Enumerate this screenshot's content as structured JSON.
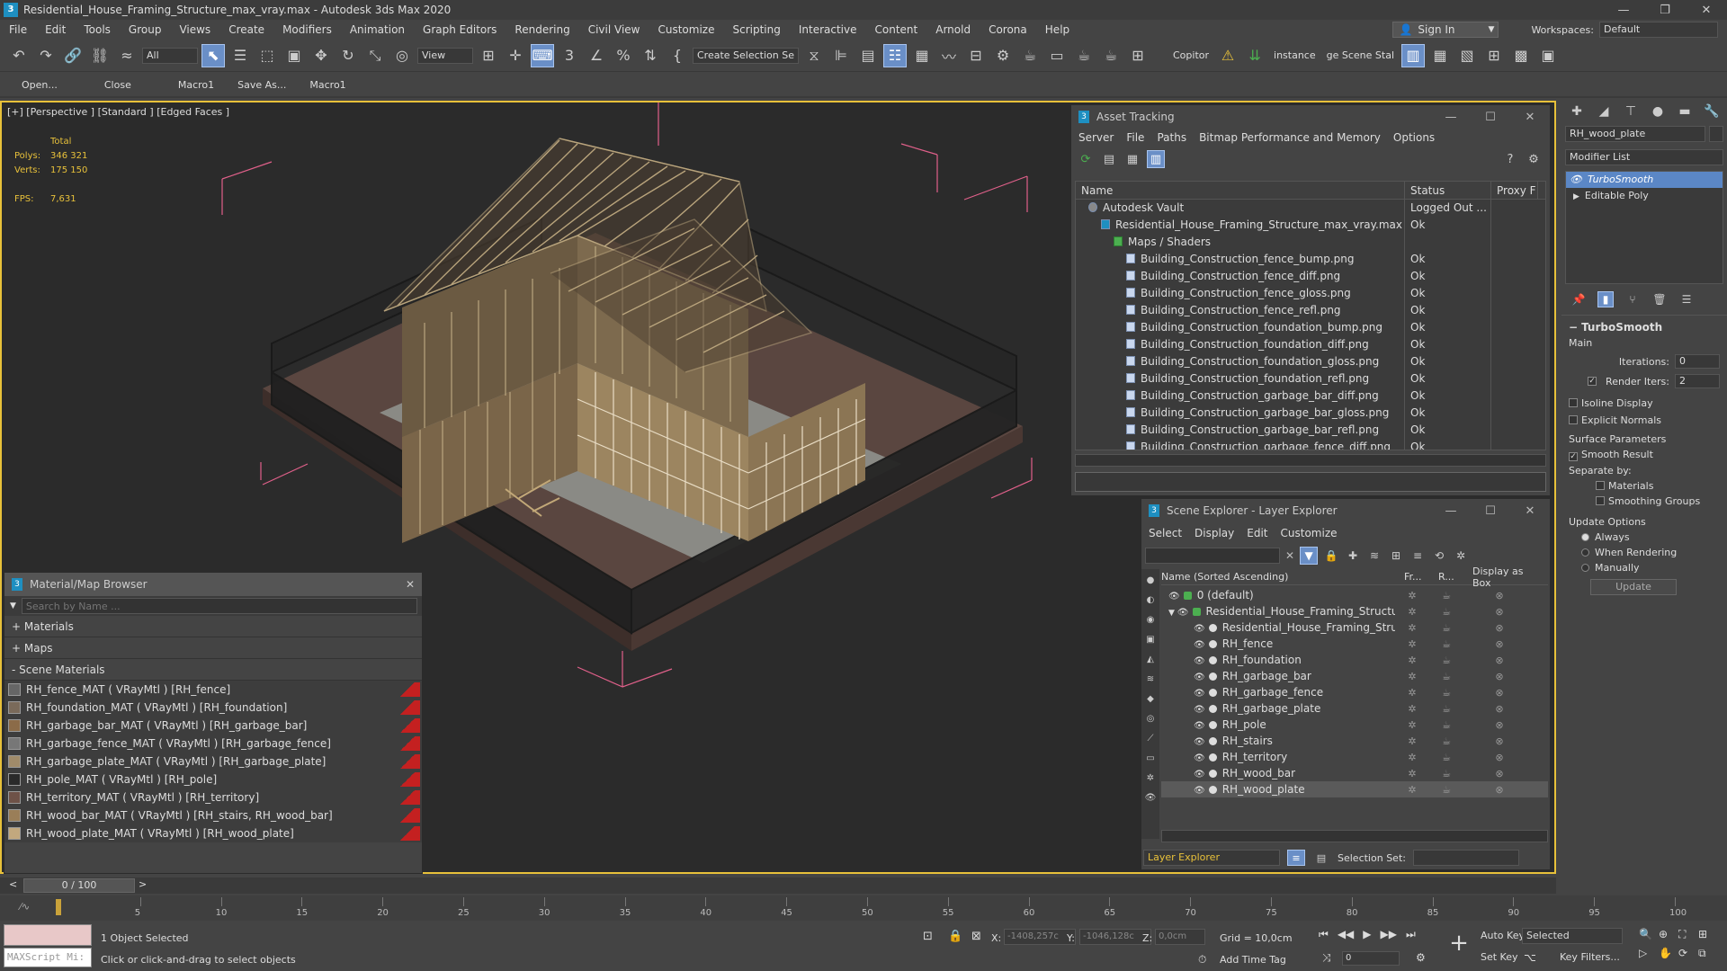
{
  "window": {
    "title": "Residential_House_Framing_Structure_max_vray.max - Autodesk 3ds Max 2020",
    "controls": [
      "—",
      "❐",
      "✕"
    ]
  },
  "menu": [
    "File",
    "Edit",
    "Tools",
    "Group",
    "Views",
    "Create",
    "Modifiers",
    "Animation",
    "Graph Editors",
    "Rendering",
    "Civil View",
    "Customize",
    "Scripting",
    "Interactive",
    "Content",
    "Arnold",
    "Corona",
    "Help"
  ],
  "account": {
    "signin": "Sign In",
    "workspaces_label": "Workspaces:",
    "workspace": "Default"
  },
  "toolbar": {
    "filter": "All",
    "refcoord": "View",
    "selection_set": "Create Selection Se",
    "copitor": "Copitor",
    "instance": "instance",
    "scene_state": "ge Scene Stal"
  },
  "macrobar": [
    "Open...",
    "Close",
    "Macro1",
    "Save As...",
    "Macro1"
  ],
  "viewport": {
    "label": "[+] [Perspective ] [Standard ] [Edged Faces ]",
    "stats": {
      "total_label": "Total",
      "polys_label": "Polys:",
      "polys": "346 321",
      "verts_label": "Verts:",
      "verts": "175 150",
      "fps_label": "FPS:",
      "fps": "7,631"
    }
  },
  "asset_tracking": {
    "title": "Asset Tracking",
    "menu": [
      "Server",
      "File",
      "Paths",
      "Bitmap Performance and Memory",
      "Options"
    ],
    "columns": [
      "Name",
      "Status",
      "Proxy F"
    ],
    "rows": [
      {
        "indent": 1,
        "name": "Autodesk Vault",
        "status": "Logged Out ..."
      },
      {
        "indent": 2,
        "name": "Residential_House_Framing_Structure_max_vray.max",
        "status": "Ok"
      },
      {
        "indent": 3,
        "name": "Maps / Shaders",
        "status": ""
      },
      {
        "indent": 4,
        "name": "Building_Construction_fence_bump.png",
        "status": "Ok"
      },
      {
        "indent": 4,
        "name": "Building_Construction_fence_diff.png",
        "status": "Ok"
      },
      {
        "indent": 4,
        "name": "Building_Construction_fence_gloss.png",
        "status": "Ok"
      },
      {
        "indent": 4,
        "name": "Building_Construction_fence_refl.png",
        "status": "Ok"
      },
      {
        "indent": 4,
        "name": "Building_Construction_foundation_bump.png",
        "status": "Ok"
      },
      {
        "indent": 4,
        "name": "Building_Construction_foundation_diff.png",
        "status": "Ok"
      },
      {
        "indent": 4,
        "name": "Building_Construction_foundation_gloss.png",
        "status": "Ok"
      },
      {
        "indent": 4,
        "name": "Building_Construction_foundation_refl.png",
        "status": "Ok"
      },
      {
        "indent": 4,
        "name": "Building_Construction_garbage_bar_diff.png",
        "status": "Ok"
      },
      {
        "indent": 4,
        "name": "Building_Construction_garbage_bar_gloss.png",
        "status": "Ok"
      },
      {
        "indent": 4,
        "name": "Building_Construction_garbage_bar_refl.png",
        "status": "Ok"
      },
      {
        "indent": 4,
        "name": "Building_Construction_garbage_fence_diff.png",
        "status": "Ok"
      }
    ]
  },
  "scene_explorer": {
    "title": "Scene Explorer - Layer Explorer",
    "menu": [
      "Select",
      "Display",
      "Edit",
      "Customize"
    ],
    "columns": [
      "Name (Sorted Ascending)",
      "Fr...",
      "R...",
      "Display as Box"
    ],
    "rows": [
      {
        "level": 0,
        "name": "0 (default)"
      },
      {
        "level": 0,
        "name": "Residential_House_Framing_Structure"
      },
      {
        "level": 1,
        "name": "Residential_House_Framing_Structure"
      },
      {
        "level": 1,
        "name": "RH_fence"
      },
      {
        "level": 1,
        "name": "RH_foundation"
      },
      {
        "level": 1,
        "name": "RH_garbage_bar"
      },
      {
        "level": 1,
        "name": "RH_garbage_fence"
      },
      {
        "level": 1,
        "name": "RH_garbage_plate"
      },
      {
        "level": 1,
        "name": "RH_pole"
      },
      {
        "level": 1,
        "name": "RH_stairs"
      },
      {
        "level": 1,
        "name": "RH_territory"
      },
      {
        "level": 1,
        "name": "RH_wood_bar"
      },
      {
        "level": 1,
        "name": "RH_wood_plate"
      }
    ],
    "footer_explorer": "Layer Explorer",
    "footer_selset": "Selection Set:"
  },
  "material_browser": {
    "title": "Material/Map Browser",
    "search_placeholder": "Search by Name ...",
    "sections": [
      "+ Materials",
      "+ Maps",
      "- Scene Materials"
    ],
    "materials": [
      "RH_fence_MAT  ( VRayMtl ) [RH_fence]",
      "RH_foundation_MAT  ( VRayMtl ) [RH_foundation]",
      "RH_garbage_bar_MAT  ( VRayMtl ) [RH_garbage_bar]",
      "RH_garbage_fence_MAT  ( VRayMtl ) [RH_garbage_fence]",
      "RH_garbage_plate_MAT  ( VRayMtl ) [RH_garbage_plate]",
      "RH_pole_MAT  ( VRayMtl ) [RH_pole]",
      "RH_territory_MAT  ( VRayMtl ) [RH_territory]",
      "RH_wood_bar_MAT  ( VRayMtl ) [RH_stairs, RH_wood_bar]",
      "RH_wood_plate_MAT  ( VRayMtl ) [RH_wood_plate]"
    ]
  },
  "command_panel": {
    "object_name": "RH_wood_plate",
    "modifier_list": "Modifier List",
    "stack": [
      "TurboSmooth",
      "Editable Poly"
    ],
    "rollout_title": "TurboSmooth",
    "main_label": "Main",
    "iterations_label": "Iterations:",
    "iterations": "0",
    "render_iters_label": "Render Iters:",
    "render_iters": "2",
    "isoline": "Isoline Display",
    "explicit_normals": "Explicit Normals",
    "surface_params": "Surface Parameters",
    "smooth_result": "Smooth Result",
    "separate_by": "Separate by:",
    "materials": "Materials",
    "smoothing_groups": "Smoothing Groups",
    "update_options": "Update Options",
    "always": "Always",
    "when_rendering": "When Rendering",
    "manually": "Manually",
    "update_button": "Update"
  },
  "timeline": {
    "frame_display": "0 / 100",
    "ticks": [
      "5",
      "10",
      "15",
      "20",
      "25",
      "30",
      "35",
      "40",
      "45",
      "50",
      "55",
      "60",
      "65",
      "70",
      "75",
      "80",
      "85",
      "90",
      "95",
      "100"
    ]
  },
  "status": {
    "maxscript": "MAXScript Mi:",
    "selected": "1 Object Selected",
    "prompt": "Click or click-and-drag to select objects",
    "x_label": "X:",
    "x": "-1408,257c",
    "y_label": "Y:",
    "y": "-1046,128c",
    "z_label": "Z:",
    "z": "0,0cm",
    "grid": "Grid = 10,0cm",
    "add_time_tag": "Add Time Tag",
    "auto_key": "Auto Key",
    "set_key": "Set Key",
    "key_mode": "Selected",
    "key_filters": "Key Filters...",
    "frame": "0"
  },
  "colors": {
    "accent": "#e8c13a",
    "selection": "#6a8fc7",
    "window_bg": "#444444",
    "viewport_bg": "#2b2b2b"
  }
}
